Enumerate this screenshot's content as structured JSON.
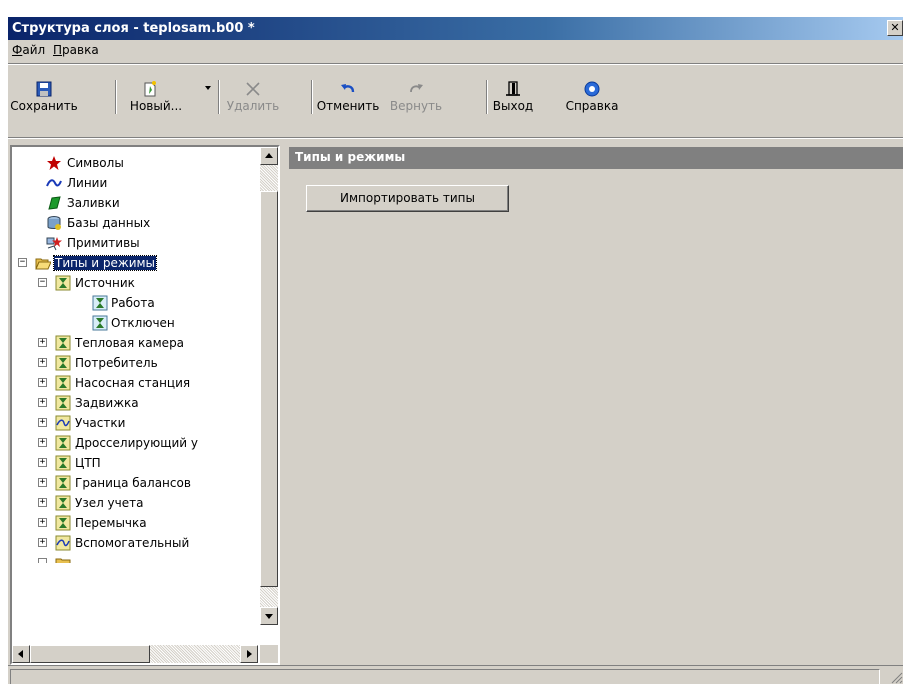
{
  "window": {
    "title": "Структура слоя - teplosam.b00 *",
    "close_glyph": "✕"
  },
  "menu": [
    {
      "label_ul": "Ф",
      "label_rest": "айл"
    },
    {
      "label_ul": "П",
      "label_rest": "равка"
    }
  ],
  "toolbar": {
    "save": "Сохранить",
    "new": "Новый...",
    "delete": "Удалить",
    "undo": "Отменить",
    "redo": "Вернуть",
    "exit": "Выход",
    "help": "Справка"
  },
  "tree": {
    "items": [
      {
        "label": "Символы",
        "icon": "star-icon"
      },
      {
        "label": "Линии",
        "icon": "line-icon"
      },
      {
        "label": "Заливки",
        "icon": "fill-icon"
      },
      {
        "label": "Базы данных",
        "icon": "database-icon"
      },
      {
        "label": "Примитивы",
        "icon": "primitives-icon"
      },
      {
        "label": "Типы и режимы",
        "icon": "folder-open-icon",
        "expander": "−",
        "selected": true
      },
      {
        "label": "Источник",
        "icon": "hourglass-icon",
        "expander": "−"
      },
      {
        "label": "Работа",
        "icon": "hourglass-icon"
      },
      {
        "label": "Отключен",
        "icon": "hourglass-icon"
      },
      {
        "label": "Тепловая камера",
        "icon": "hourglass-icon",
        "expander": "+"
      },
      {
        "label": "Потребитель",
        "icon": "hourglass-icon",
        "expander": "+"
      },
      {
        "label": "Насосная станция",
        "icon": "hourglass-icon",
        "expander": "+"
      },
      {
        "label": "Задвижка",
        "icon": "hourglass-icon",
        "expander": "+"
      },
      {
        "label": "Участки",
        "icon": "wave-icon",
        "expander": "+"
      },
      {
        "label": "Дросселирующий у",
        "icon": "hourglass-icon",
        "expander": "+"
      },
      {
        "label": "ЦТП",
        "icon": "hourglass-icon",
        "expander": "+"
      },
      {
        "label": "Граница балансов",
        "icon": "hourglass-icon",
        "expander": "+"
      },
      {
        "label": "Узел учета",
        "icon": "hourglass-icon",
        "expander": "+"
      },
      {
        "label": "Перемычка",
        "icon": "hourglass-icon",
        "expander": "+"
      },
      {
        "label": "Вспомогательный",
        "icon": "wave-icon",
        "expander": "+"
      }
    ]
  },
  "panel": {
    "header": "Типы и режимы",
    "import_button": "Импортировать типы"
  }
}
